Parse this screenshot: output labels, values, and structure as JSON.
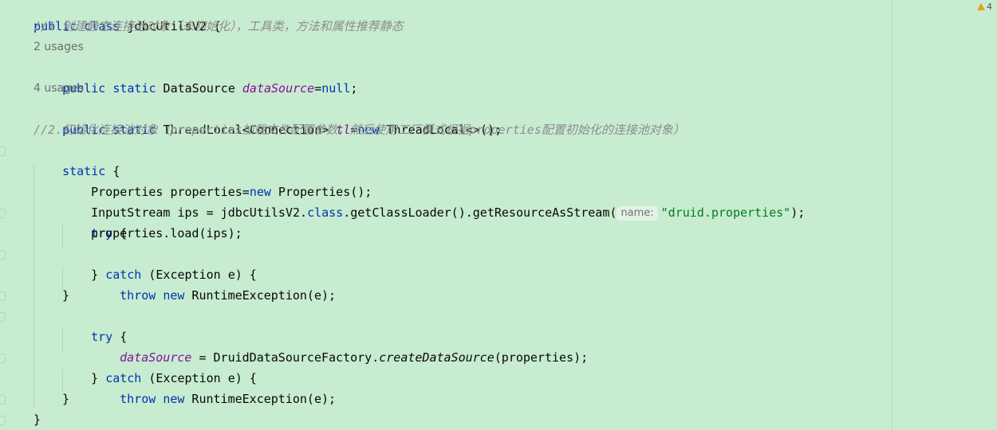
{
  "editor": {
    "warning_count": "4",
    "lines": {
      "l1": [
        "public",
        " ",
        "class",
        " ",
        "jdbcUtilsV2",
        " {"
      ],
      "l2": "//1.创建静态连接池对象（未初始化），工具类，方法和属性推荐静态",
      "l3": "2 usages",
      "l4": [
        "public",
        " ",
        "static",
        " DataSource ",
        "dataSource",
        "=",
        "null",
        ";"
      ],
      "l5": "4 usages",
      "l6": [
        "public",
        " ",
        "static",
        " ThreadLocal<Connection> ",
        "tl",
        "=",
        "new",
        " ThreadLocal<>();"
      ],
      "l7": "//2.初始化连接池对象（properties加载文件配置参数，然后使用工厂模式根据properties配置初始化的连接池对象）",
      "l8": [
        "static",
        " {"
      ],
      "l9": [
        "Properties properties=",
        "new",
        " Properties();"
      ],
      "l10": [
        "InputStream ips = jdbcUtilsV2.",
        "class",
        ".getClassLoader().getResourceAsStream(",
        "name:",
        "\"druid.properties\"",
        ");"
      ],
      "l11": [
        "try",
        " {"
      ],
      "l12": "properties.load(ips);",
      "l13": [
        "} ",
        "catch",
        " (Exception e) {"
      ],
      "l14": [
        "throw",
        " ",
        "new",
        " RuntimeException(e);"
      ],
      "l15": "}",
      "l16": [
        "try",
        " {"
      ],
      "l17": [
        "dataSource",
        " = DruidDataSourceFactory.",
        "createDataSource",
        "(properties);"
      ],
      "l18": [
        "} ",
        "catch",
        " (Exception e) {"
      ],
      "l19": [
        "throw",
        " ",
        "new",
        " RuntimeException(e);"
      ],
      "l20": "}",
      "l21": "}"
    }
  },
  "colors": {
    "background": "#c7ecd0",
    "keyword": "#0033b3",
    "field": "#871094",
    "comment": "#8c8c8c",
    "string": "#067d17",
    "warning": "#e3a21a"
  }
}
